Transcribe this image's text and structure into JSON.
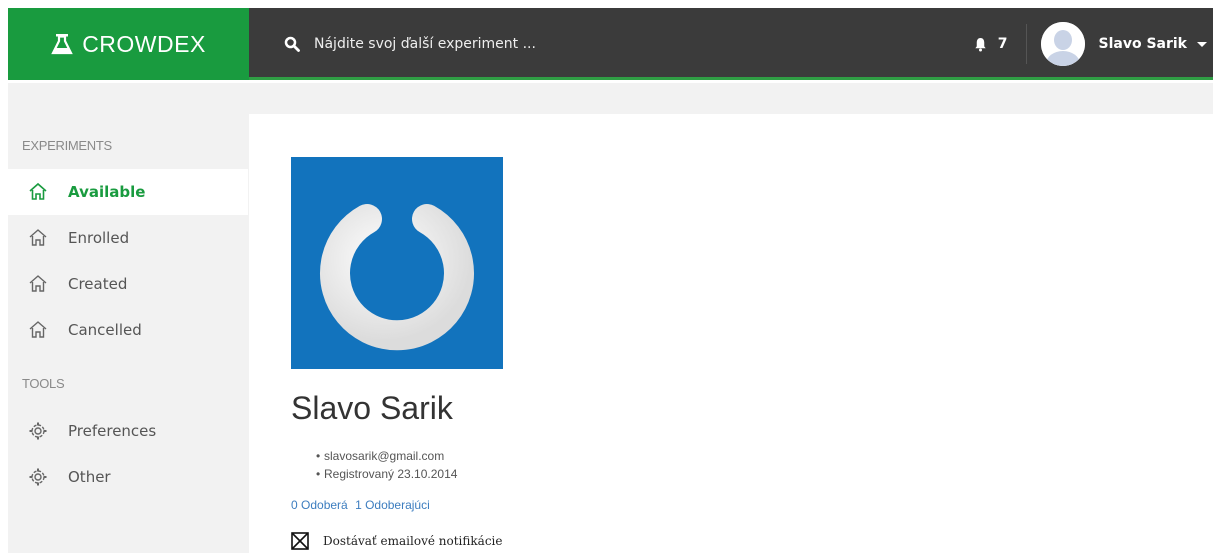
{
  "brand": {
    "name": "CROWDEX",
    "color": "#199b3f"
  },
  "search": {
    "placeholder": "Nájdite svoj ďalší experiment ..."
  },
  "header": {
    "notification_count": "7",
    "user_name": "Slavo Sarik"
  },
  "sidebar": {
    "experiments_title": "EXPERIMENTS",
    "experiments": [
      {
        "label": "Available",
        "active": true,
        "icon": "home-icon"
      },
      {
        "label": "Enrolled",
        "icon": "home-icon"
      },
      {
        "label": "Created",
        "icon": "home-icon"
      },
      {
        "label": "Cancelled",
        "icon": "home-icon"
      }
    ],
    "tools_title": "TOOLS",
    "tools": [
      {
        "label": "Preferences",
        "icon": "gear-icon"
      },
      {
        "label": "Other",
        "icon": "gear-icon"
      }
    ]
  },
  "profile": {
    "name": "Slavo Sarik",
    "email": "slavosarik@gmail.com",
    "registered": "Registrovaný 23.10.2014",
    "following": "0 Odoberá",
    "followers": "1 Odoberajúci",
    "email_notifications": "Dostávať emailové notifikácie",
    "picture_color": "#1273bd"
  }
}
